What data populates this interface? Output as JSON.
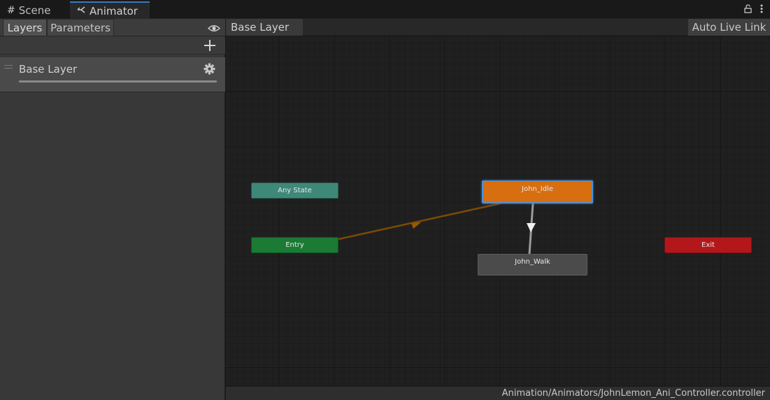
{
  "tabs": [
    {
      "label": "Scene",
      "icon": "grid-icon"
    },
    {
      "label": "Animator",
      "icon": "animator-icon",
      "active": true
    }
  ],
  "left_panel": {
    "toolbar": {
      "layers_label": "Layers",
      "parameters_label": "Parameters"
    },
    "layers": [
      {
        "name": "Base Layer"
      }
    ]
  },
  "graph": {
    "breadcrumb": "Base Layer",
    "live_link_label": "Auto Live Link",
    "states": {
      "any_state": "Any State",
      "entry": "Entry",
      "exit": "Exit",
      "john_idle": "John_Idle",
      "john_walk": "John_Walk"
    },
    "transitions": [
      {
        "from": "Entry",
        "to": "John_Idle",
        "kind": "default"
      },
      {
        "from": "John_Idle",
        "to": "John_Walk",
        "kind": "normal"
      }
    ],
    "default_state": "John_Idle"
  },
  "status_bar": {
    "path": "Animation/Animators/JohnLemon_Ani_Controller.controller"
  },
  "colors": {
    "accent_blue": "#3a79bb",
    "default_state_orange": "#d76e0f",
    "entry_green": "#1b7a33",
    "exit_red": "#b3171a",
    "any_state_teal": "#3e8879",
    "default_transition": "#9a5a05"
  }
}
